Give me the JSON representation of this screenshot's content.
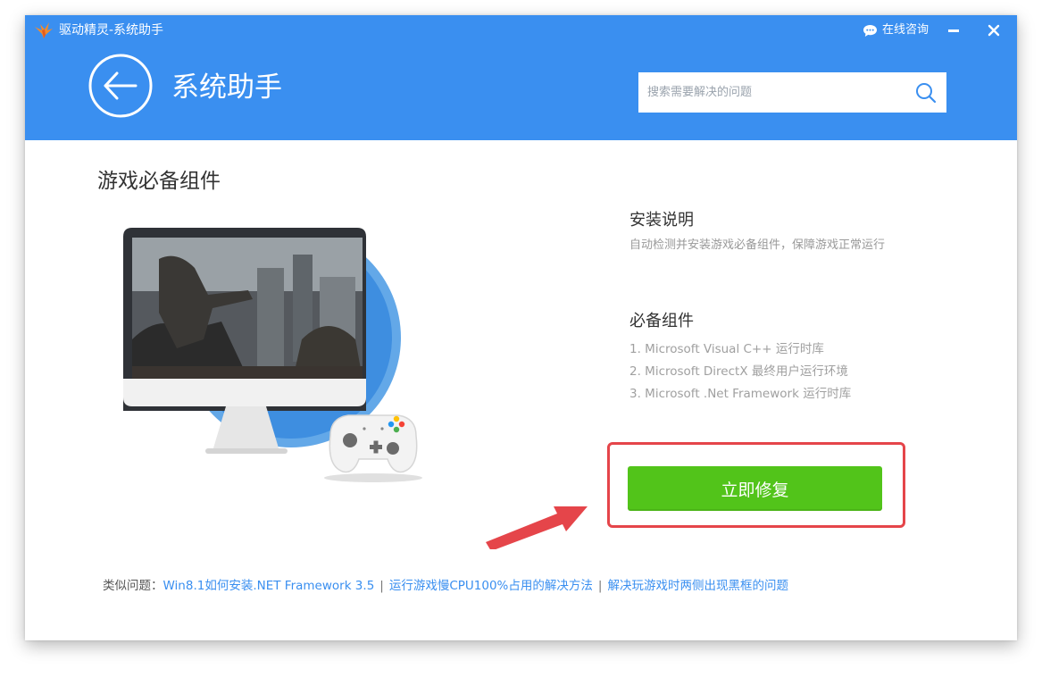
{
  "window": {
    "app_title": "驱动精灵-系统助手",
    "consult_label": "在线咨询",
    "minimize_label": "–",
    "close_label": "×"
  },
  "header": {
    "page_title": "系统助手",
    "search_placeholder": "搜索需要解决的问题",
    "search_value": ""
  },
  "main": {
    "section_title": "游戏必备组件",
    "install_heading": "安装说明",
    "install_desc": "自动检测并安装游戏必备组件，保障游戏正常运行",
    "components_heading": "必备组件",
    "components": [
      "1. Microsoft Visual C++ 运行时库",
      "2. Microsoft  DirectX 最终用户运行环境",
      "3. Microsoft .Net Framework 运行时库"
    ],
    "fix_button_label": "立即修复"
  },
  "footer": {
    "related_label": "类似问题：",
    "links": [
      "Win8.1如何安装.NET Framework 3.5",
      "运行游戏慢CPU100%占用的解决方法",
      "解决玩游戏时两侧出现黑框的问题"
    ],
    "separator": "|"
  },
  "colors": {
    "header_blue": "#3a8ff0",
    "button_green": "#52c41a",
    "highlight_red": "#e5454a",
    "link_blue": "#3a8ff0"
  },
  "icons": {
    "app_logo": "bird-logo-icon",
    "consult": "chat-bubble-icon",
    "back": "back-arrow-icon",
    "search": "search-icon",
    "annotation": "red-arrow-icon"
  }
}
